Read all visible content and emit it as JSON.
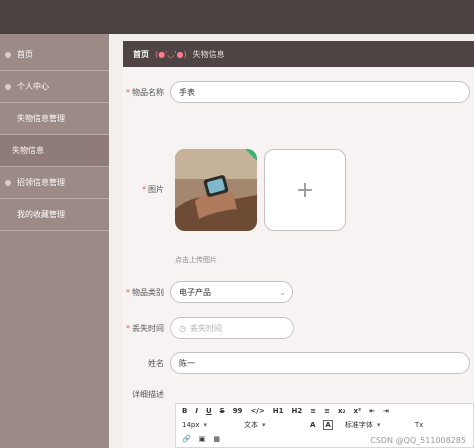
{
  "sidebar": {
    "items": [
      {
        "label": "首页"
      },
      {
        "label": "个人中心"
      },
      {
        "label": "失物信息管理"
      },
      {
        "label": "失物信息"
      },
      {
        "label": "招领信息管理"
      },
      {
        "label": "我的收藏管理"
      }
    ]
  },
  "breadcrumb": {
    "home": "首页",
    "face": "(●'◡'●)",
    "current": "失物信息"
  },
  "form": {
    "name": {
      "label": "物品名称",
      "value": "手表"
    },
    "image": {
      "label": "图片",
      "hint": "点击上传图片",
      "add_icon": "+"
    },
    "category": {
      "label": "物品类别",
      "value": "电子产品"
    },
    "lost_time": {
      "label": "丢失时间",
      "placeholder": "丢失时间"
    },
    "owner": {
      "label": "姓名",
      "value": "陈一"
    },
    "detail": {
      "label": "详细描述"
    },
    "required_mark": "*"
  },
  "editor": {
    "row1": [
      "B",
      "I",
      "U",
      "S",
      "99",
      "</>",
      "H1",
      "H2",
      "≡",
      "≡",
      "x₂",
      "x²",
      "⇤",
      "⇥"
    ],
    "font_size": "14px",
    "text_type": "文本",
    "font_family": "标准字体",
    "clear": "Tx"
  },
  "watermark": "CSDN @QQ_511008285",
  "colors": {
    "sidebar": "#9c8a86",
    "topbar": "#4a4140",
    "accent_face": "#ff7a8c"
  }
}
